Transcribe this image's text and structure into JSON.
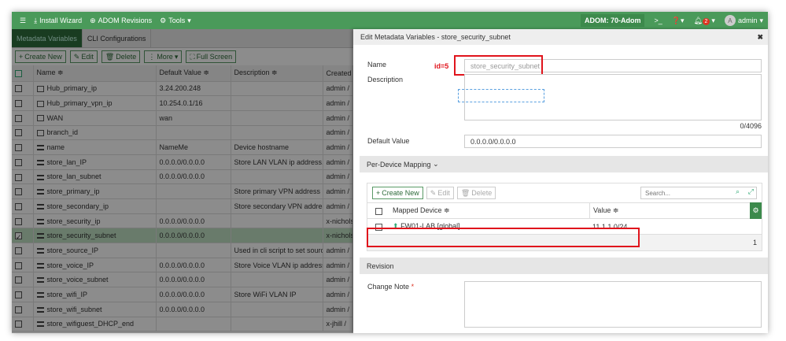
{
  "topbar": {
    "install_wizard": "Install Wizard",
    "adom_revisions": "ADOM Revisions",
    "tools": "Tools",
    "adom": "ADOM: 70-Adom",
    "notifications": "2",
    "avatar": "A",
    "user": "admin"
  },
  "tabs": [
    "Metadata Variables",
    "CLI Configurations"
  ],
  "toolbar": {
    "create": "Create New",
    "edit": "Edit",
    "delete": "Delete",
    "more": "More",
    "fullscreen": "Full Screen"
  },
  "columns": [
    "Name ≑",
    "Default Value ≑",
    "Description ≑",
    "Created"
  ],
  "rows": [
    {
      "type": "list",
      "name": "Hub_primary_ip",
      "value": "3.24.200.248",
      "desc": "",
      "created": "admin /"
    },
    {
      "type": "list",
      "name": "Hub_primary_vpn_ip",
      "value": "10.254.0.1/16",
      "desc": "",
      "created": "admin /"
    },
    {
      "type": "list",
      "name": "WAN",
      "value": "wan",
      "desc": "",
      "created": "admin /"
    },
    {
      "type": "list",
      "name": "branch_id",
      "value": "",
      "desc": "",
      "created": "admin /"
    },
    {
      "type": "var",
      "name": "name",
      "value": "NameMe",
      "desc": "Device hostname",
      "created": "admin /"
    },
    {
      "type": "var",
      "name": "store_lan_IP",
      "value": "0.0.0.0/0.0.0.0",
      "desc": "Store LAN VLAN ip address.",
      "created": "admin /"
    },
    {
      "type": "var",
      "name": "store_lan_subnet",
      "value": "0.0.0.0/0.0.0.0",
      "desc": "",
      "created": "admin /"
    },
    {
      "type": "var",
      "name": "store_primary_ip",
      "value": "",
      "desc": "Store primary VPN address",
      "created": "admin /"
    },
    {
      "type": "var",
      "name": "store_secondary_ip",
      "value": "",
      "desc": "Store secondary VPN address",
      "created": "admin /"
    },
    {
      "type": "var",
      "name": "store_security_ip",
      "value": "0.0.0.0/0.0.0.0",
      "desc": "",
      "created": "x-nichols"
    },
    {
      "type": "var",
      "name": "store_security_subnet",
      "value": "0.0.0.0/0.0.0.0",
      "desc": "",
      "created": "x-nichols",
      "selected": true
    },
    {
      "type": "var",
      "name": "store_source_IP",
      "value": "",
      "desc": "Used in cli script to set source",
      "created": "admin /"
    },
    {
      "type": "var",
      "name": "store_voice_IP",
      "value": "0.0.0.0/0.0.0.0",
      "desc": "Store Voice VLAN ip address.",
      "created": "admin /"
    },
    {
      "type": "var",
      "name": "store_voice_subnet",
      "value": "0.0.0.0/0.0.0.0",
      "desc": "",
      "created": "admin /"
    },
    {
      "type": "var",
      "name": "store_wifi_IP",
      "value": "0.0.0.0/0.0.0.0",
      "desc": "Store WiFi VLAN IP",
      "created": "admin /"
    },
    {
      "type": "var",
      "name": "store_wifi_subnet",
      "value": "0.0.0.0/0.0.0.0",
      "desc": "",
      "created": "admin /"
    },
    {
      "type": "var",
      "name": "store_wifiguest_DHCP_end",
      "value": "",
      "desc": "",
      "created": "x-jhill /"
    }
  ],
  "dialog": {
    "title": "Edit Metadata Variables - store_security_subnet",
    "name_label": "Name",
    "name_value": "store_security_subnet",
    "annotation": "id=5",
    "desc_label": "Description",
    "counter": "0/4096",
    "default_label": "Default Value",
    "default_value": "0.0.0.0/0.0.0.0",
    "mapping_label": "Per-Device Mapping",
    "create": "Create New",
    "edit": "Edit",
    "delete": "Delete",
    "search_placeholder": "Search...",
    "col_device": "Mapped Device ≑",
    "col_value": "Value ≑",
    "device": "FW01-LAB [global]",
    "device_value": "11.1.1.0/24",
    "count": "1",
    "revision_label": "Revision",
    "change_note_label": "Change Note",
    "required": "*"
  }
}
